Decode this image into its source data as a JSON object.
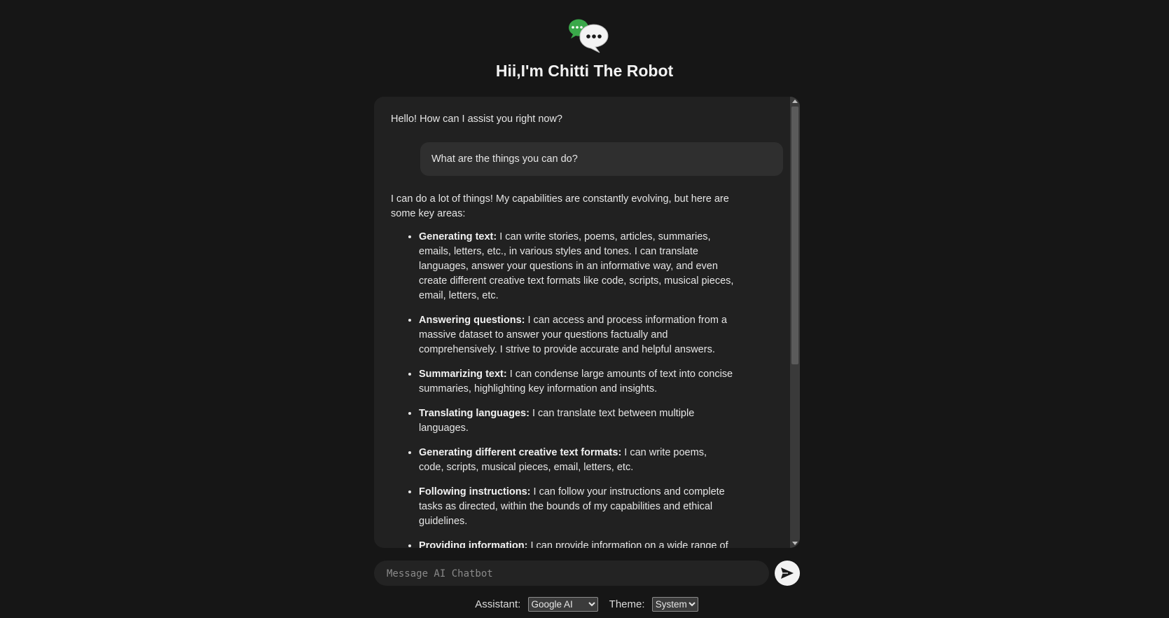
{
  "header": {
    "logo_icon": "chat-bubbles-icon",
    "title": "Hii,I'm Chitti The Robot"
  },
  "chat": {
    "greeting": "Hello! How can I assist you right now?",
    "user_question": "What are the things you can do?",
    "answer_intro": "I can do a lot of things! My capabilities are constantly evolving, but here are some key areas:",
    "capabilities": [
      {
        "title": "Generating text:",
        "text": " I can write stories, poems, articles, summaries, emails, letters, etc., in various styles and tones. I can translate languages, answer your questions in an informative way, and even create different creative text formats like code, scripts, musical pieces, email, letters, etc."
      },
      {
        "title": "Answering questions:",
        "text": " I can access and process information from a massive dataset to answer your questions factually and comprehensively. I strive to provide accurate and helpful answers."
      },
      {
        "title": "Summarizing text:",
        "text": " I can condense large amounts of text into concise summaries, highlighting key information and insights."
      },
      {
        "title": "Translating languages:",
        "text": " I can translate text between multiple languages."
      },
      {
        "title": "Generating different creative text formats:",
        "text": " I can write poems, code, scripts, musical pieces, email, letters, etc."
      },
      {
        "title": "Following instructions:",
        "text": " I can follow your instructions and complete tasks as directed, within the bounds of my capabilities and ethical guidelines."
      },
      {
        "title": "Providing information:",
        "text": " I can provide information on a wide range of"
      }
    ]
  },
  "composer": {
    "placeholder": "Message AI Chatbot",
    "send_icon": "send-arrow-icon"
  },
  "controls": {
    "assistant_label": "Assistant:",
    "assistant_value": "Google AI",
    "theme_label": "Theme:",
    "theme_value": "System"
  },
  "colors": {
    "background": "#161616",
    "chat_panel": "#212121",
    "user_bubble": "#2f2f2f",
    "logo_green": "#3aa84a"
  }
}
